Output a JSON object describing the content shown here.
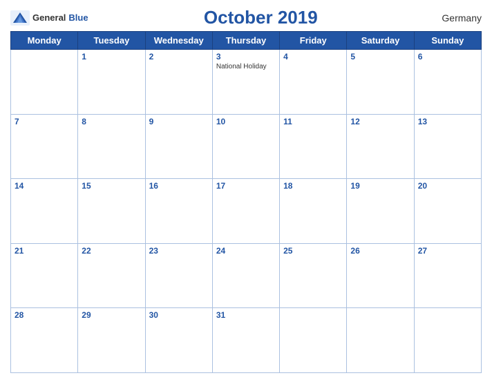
{
  "header": {
    "title": "October 2019",
    "country": "Germany",
    "logo_general": "General",
    "logo_blue": "Blue"
  },
  "weekdays": [
    "Monday",
    "Tuesday",
    "Wednesday",
    "Thursday",
    "Friday",
    "Saturday",
    "Sunday"
  ],
  "weeks": [
    [
      {
        "day": "",
        "empty": true
      },
      {
        "day": "1"
      },
      {
        "day": "2"
      },
      {
        "day": "3",
        "holiday": "National Holiday"
      },
      {
        "day": "4"
      },
      {
        "day": "5"
      },
      {
        "day": "6"
      }
    ],
    [
      {
        "day": "7"
      },
      {
        "day": "8"
      },
      {
        "day": "9"
      },
      {
        "day": "10"
      },
      {
        "day": "11"
      },
      {
        "day": "12"
      },
      {
        "day": "13"
      }
    ],
    [
      {
        "day": "14"
      },
      {
        "day": "15"
      },
      {
        "day": "16"
      },
      {
        "day": "17"
      },
      {
        "day": "18"
      },
      {
        "day": "19"
      },
      {
        "day": "20"
      }
    ],
    [
      {
        "day": "21"
      },
      {
        "day": "22"
      },
      {
        "day": "23"
      },
      {
        "day": "24"
      },
      {
        "day": "25"
      },
      {
        "day": "26"
      },
      {
        "day": "27"
      }
    ],
    [
      {
        "day": "28"
      },
      {
        "day": "29"
      },
      {
        "day": "30"
      },
      {
        "day": "31"
      },
      {
        "day": "",
        "empty": true
      },
      {
        "day": "",
        "empty": true
      },
      {
        "day": "",
        "empty": true
      }
    ]
  ]
}
